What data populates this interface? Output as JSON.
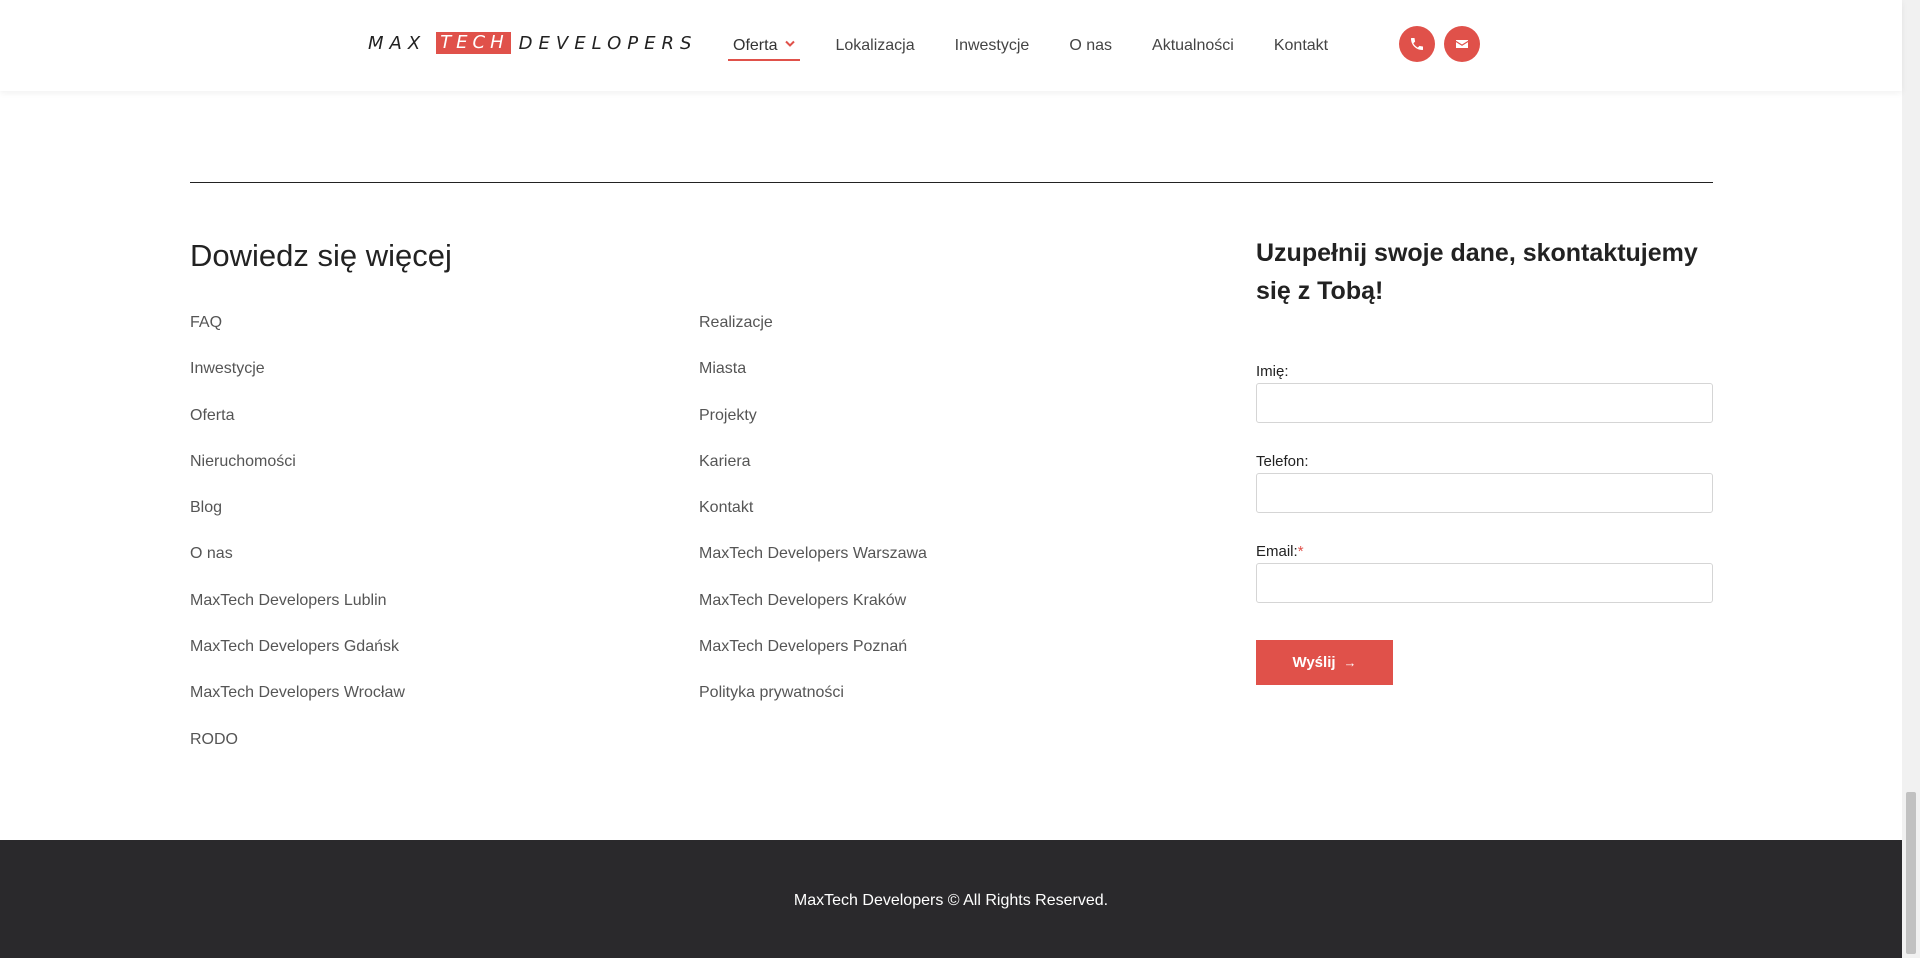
{
  "header": {
    "logo": {
      "part1": "MAX",
      "part2": "TECH",
      "part3": "DEVELOPERS"
    },
    "nav": [
      {
        "label": "Oferta"
      },
      {
        "label": "Lokalizacja"
      },
      {
        "label": "Inwestycje"
      },
      {
        "label": "O nas"
      },
      {
        "label": "Aktualności"
      },
      {
        "label": "Kontakt"
      }
    ],
    "icons": {
      "phone": "phone-icon",
      "email": "envelope-icon"
    }
  },
  "links": {
    "title": "Dowiedz się więcej",
    "col1": [
      "FAQ",
      "Inwestycje",
      "Oferta",
      "Nieruchomości",
      "Blog",
      "O nas",
      "MaxTech Developers Lublin",
      "MaxTech Developers Gdańsk",
      "MaxTech Developers Wrocław",
      "RODO"
    ],
    "col2": [
      "Realizacje",
      "Miasta",
      "Projekty",
      "Kariera",
      "Kontakt",
      "MaxTech Developers Warszawa",
      "MaxTech Developers Kraków",
      "MaxTech Developers Poznań",
      "Polityka prywatności"
    ]
  },
  "form": {
    "title": "Uzupełnij swoje dane, skontaktujemy się z Tobą!",
    "name_label": "Imię:",
    "phone_label": "Telefon:",
    "email_label": "Email:",
    "required_mark": "*",
    "name_value": "",
    "phone_value": "",
    "email_value": "",
    "submit_label": "Wyślij",
    "submit_arrow": "→"
  },
  "footer": {
    "copyright": "MaxTech Developers © All Rights Reserved."
  },
  "colors": {
    "accent": "#e0514a",
    "footer_bg": "#2a292c"
  }
}
